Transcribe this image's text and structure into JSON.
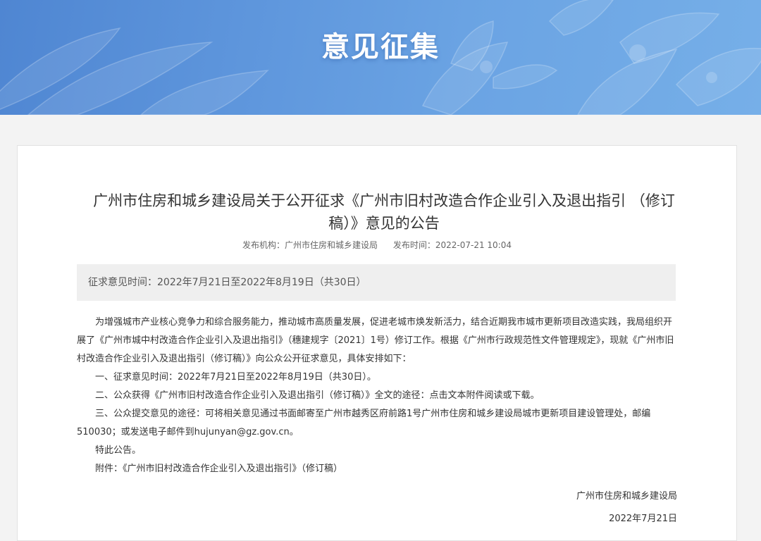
{
  "banner": {
    "title": "意见征集"
  },
  "article": {
    "title": "广州市住房和城乡建设局关于公开征求《广州市旧村改造合作企业引入及退出指引 （修订稿）》意见的公告",
    "meta": {
      "publisher": "发布机构：广州市住房和城乡建设局",
      "publish_time": "发布时间：2022-07-21 10:04"
    },
    "period_box": "征求意见时间：2022年7月21日至2022年8月19日（共30日）",
    "paragraphs": [
      "为增强城市产业核心竞争力和综合服务能力，推动城市高质量发展，促进老城市焕发新活力，结合近期我市城市更新项目改造实践，我局组织开展了《广州市城中村改造合作企业引入及退出指引》（穗建规字〔2021〕1号）修订工作。根据《广州市行政规范性文件管理规定》，现就《广州市旧村改造合作企业引入及退出指引（修订稿）》向公众公开征求意见，具体安排如下：",
      "一、征求意见时间：2022年7月21日至2022年8月19日（共30日）。",
      "二、公众获得《广州市旧村改造合作企业引入及退出指引（修订稿）》全文的途径：点击文本附件阅读或下载。",
      "三、公众提交意见的途径：可将相关意见通过书面邮寄至广州市越秀区府前路1号广州市住房和城乡建设局城市更新项目建设管理处，邮编510030；或发送电子邮件到hujunyan@gz.gov.cn。",
      "特此公告。",
      "附件：《广州市旧村改造合作企业引入及退出指引》（修订稿）"
    ],
    "signature": {
      "org": "广州市住房和城乡建设局",
      "date": "2022年7月21日"
    }
  }
}
